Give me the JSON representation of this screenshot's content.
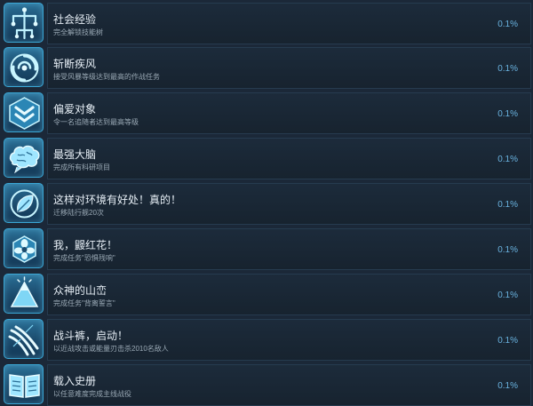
{
  "achievements": [
    {
      "title": "社会经验",
      "description": "完全解锁技能树",
      "percent": "0.1%",
      "icon": "tree-icon"
    },
    {
      "title": "斩断疾风",
      "description": "接受风暴等级达到最高的作战任务",
      "percent": "0.1%",
      "icon": "storm-icon"
    },
    {
      "title": "偏爱对象",
      "description": "令一名追随者达到最高等级",
      "percent": "0.1%",
      "icon": "chevron-rank-icon"
    },
    {
      "title": "最强大脑",
      "description": "完成所有科研项目",
      "percent": "0.1%",
      "icon": "brain-icon"
    },
    {
      "title": "这样对环境有好处！真的！",
      "description": "迁移陆行舰20次",
      "percent": "0.1%",
      "icon": "leaf-icon"
    },
    {
      "title": "我，鼹红花！",
      "description": "完成任务\"恐惧残响\"",
      "percent": "0.1%",
      "icon": "flower-icon"
    },
    {
      "title": "众神的山峦",
      "description": "完成任务\"背离誓言\"",
      "percent": "0.1%",
      "icon": "mountain-icon"
    },
    {
      "title": "战斗裤，启动！",
      "description": "以近战攻击或能量刃击杀2010名敌人",
      "percent": "0.1%",
      "icon": "claw-slash-icon"
    },
    {
      "title": "载入史册",
      "description": "以任意难度完成主线战役",
      "percent": "0.1%",
      "icon": "book-icon"
    }
  ]
}
